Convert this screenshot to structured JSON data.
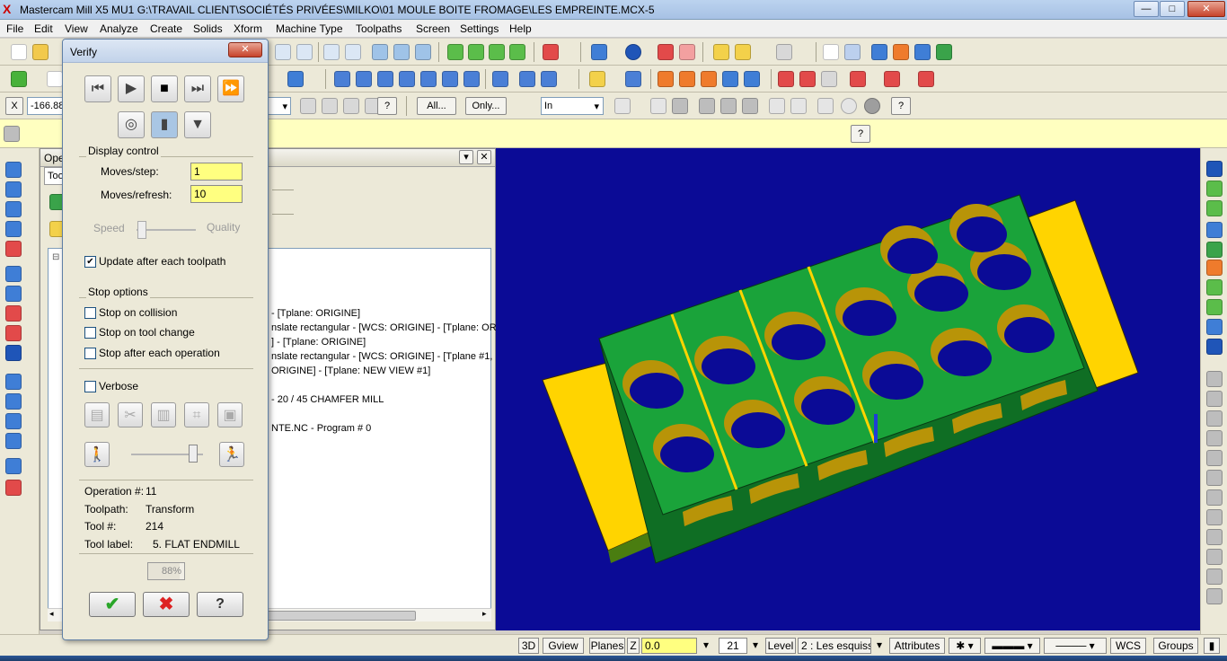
{
  "app": {
    "title": "Mastercam Mill X5 MU1  G:\\TRAVAIL CLIENT\\SOCIÉTÉS PRIVÉES\\MILKO\\01 MOULE BOITE FROMAGE\\LES EMPREINTE.MCX-5",
    "min_glyph": "—",
    "max_glyph": "□",
    "close_glyph": "✕"
  },
  "menu": [
    "File",
    "Edit",
    "View",
    "Analyze",
    "Create",
    "Solids",
    "Xform",
    "Machine Type",
    "Toolpaths",
    "Screen",
    "Settings",
    "Help"
  ],
  "ribbon": {
    "x_field": "-166.88",
    "all_label": "All...",
    "only_label": "Only...",
    "unit_select": "In",
    "help_glyph": "?"
  },
  "opmgr": {
    "title": "Ope",
    "tab": "Too",
    "close_glyph": "✕",
    "dropdown_glyph": "▾",
    "lines": [
      "- [Tplane: ORIGINE]",
      "nslate rectangular - [WCS: ORIGINE] - [Tplane: ORI",
      "] - [Tplane: ORIGINE]",
      "nslate rectangular - [WCS: ORIGINE] - [Tplane #1,",
      "ORIGINE] - [Tplane: NEW VIEW #1]",
      "-   20 / 45 CHAMFER MILL",
      "NTE.NC - Program # 0"
    ]
  },
  "verify": {
    "title": "Verify",
    "close_glyph": "✕",
    "display_control": "Display control",
    "moves_step_label": "Moves/step:",
    "moves_step_value": "1",
    "moves_refresh_label": "Moves/refresh:",
    "moves_refresh_value": "10",
    "speed_label": "Speed",
    "quality_label": "Quality",
    "update_label": "Update after each toolpath",
    "update_checked": true,
    "stop_options": "Stop options",
    "stop_collision": "Stop on collision",
    "stop_tool_change": "Stop on tool change",
    "stop_operation": "Stop after each operation",
    "verbose": "Verbose",
    "operation_label": "Operation #:",
    "operation_value": "11",
    "toolpath_label": "Toolpath:",
    "toolpath_value": "Transform",
    "tool_num_label": "Tool #:",
    "tool_num_value": "214",
    "tool_label_label": "Tool label:",
    "tool_label_value": "5. FLAT ENDMILL",
    "progress": "88%",
    "progress_value": 0.88,
    "ok_glyph": "✔",
    "cancel_glyph": "✖",
    "help_glyph": "?",
    "check_glyph": "✔"
  },
  "status": {
    "view3d": "3D",
    "gview": "Gview",
    "planes": "Planes",
    "z_label": "Z",
    "z_value": "0.0",
    "level_num": "21",
    "level_label": "Level",
    "level_value": "2 : Les esquiss",
    "attributes": "Attributes",
    "wcs": "WCS",
    "groups": "Groups"
  },
  "colors": {
    "viewport_bg": "#0b0b96",
    "part_green": "#1aa33a",
    "part_yellow": "#ffd400",
    "pocket_wall": "#b89408"
  }
}
